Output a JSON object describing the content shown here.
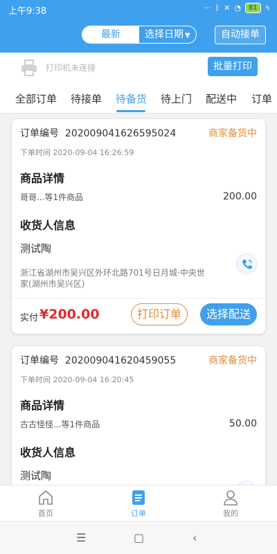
{
  "status_bar": {
    "time": "上午9:38",
    "battery": "81"
  },
  "header": {
    "segment_latest": "最新",
    "segment_date": "选择日期",
    "auto_accept": "自动接单"
  },
  "printer": {
    "status": "打印机未连接",
    "batch_print": "批量打印"
  },
  "tabs": [
    {
      "label": "全部订单"
    },
    {
      "label": "待接单"
    },
    {
      "label": "待备货"
    },
    {
      "label": "待上门"
    },
    {
      "label": "配送中"
    },
    {
      "label": "订单"
    }
  ],
  "orders": [
    {
      "order_label": "订单编号",
      "order_no": "202009041626595024",
      "status": "商家备货中",
      "order_time": "下单时间 2020-09-04 16:26:59",
      "goods_title": "商品详情",
      "goods_desc": "哥哥...等1件商品",
      "goods_price": "200.00",
      "receiver_title": "收货人信息",
      "receiver_name": "测试陶",
      "address": "浙江省湖州市吴兴区外环北路701号日月城·中央世家(湖州市吴兴区)",
      "paid_label": "实付",
      "paid_amount": "¥200.00",
      "print_btn": "打印订单",
      "deliver_btn": "选择配送"
    },
    {
      "order_label": "订单编号",
      "order_no": "202009041620459055",
      "status": "商家备货中",
      "order_time": "下单时间 2020-09-04 16:20:45",
      "goods_title": "商品详情",
      "goods_desc": "古古怪怪...等1件商品",
      "goods_price": "50.00",
      "receiver_title": "收货人信息",
      "receiver_name": "测试陶"
    }
  ],
  "tabbar": {
    "home": "首页",
    "orders": "订单",
    "mine": "我的"
  },
  "colors": {
    "primary": "#3fa0ee",
    "status_orange": "#e08a3c",
    "price_red": "#e02b2b"
  }
}
